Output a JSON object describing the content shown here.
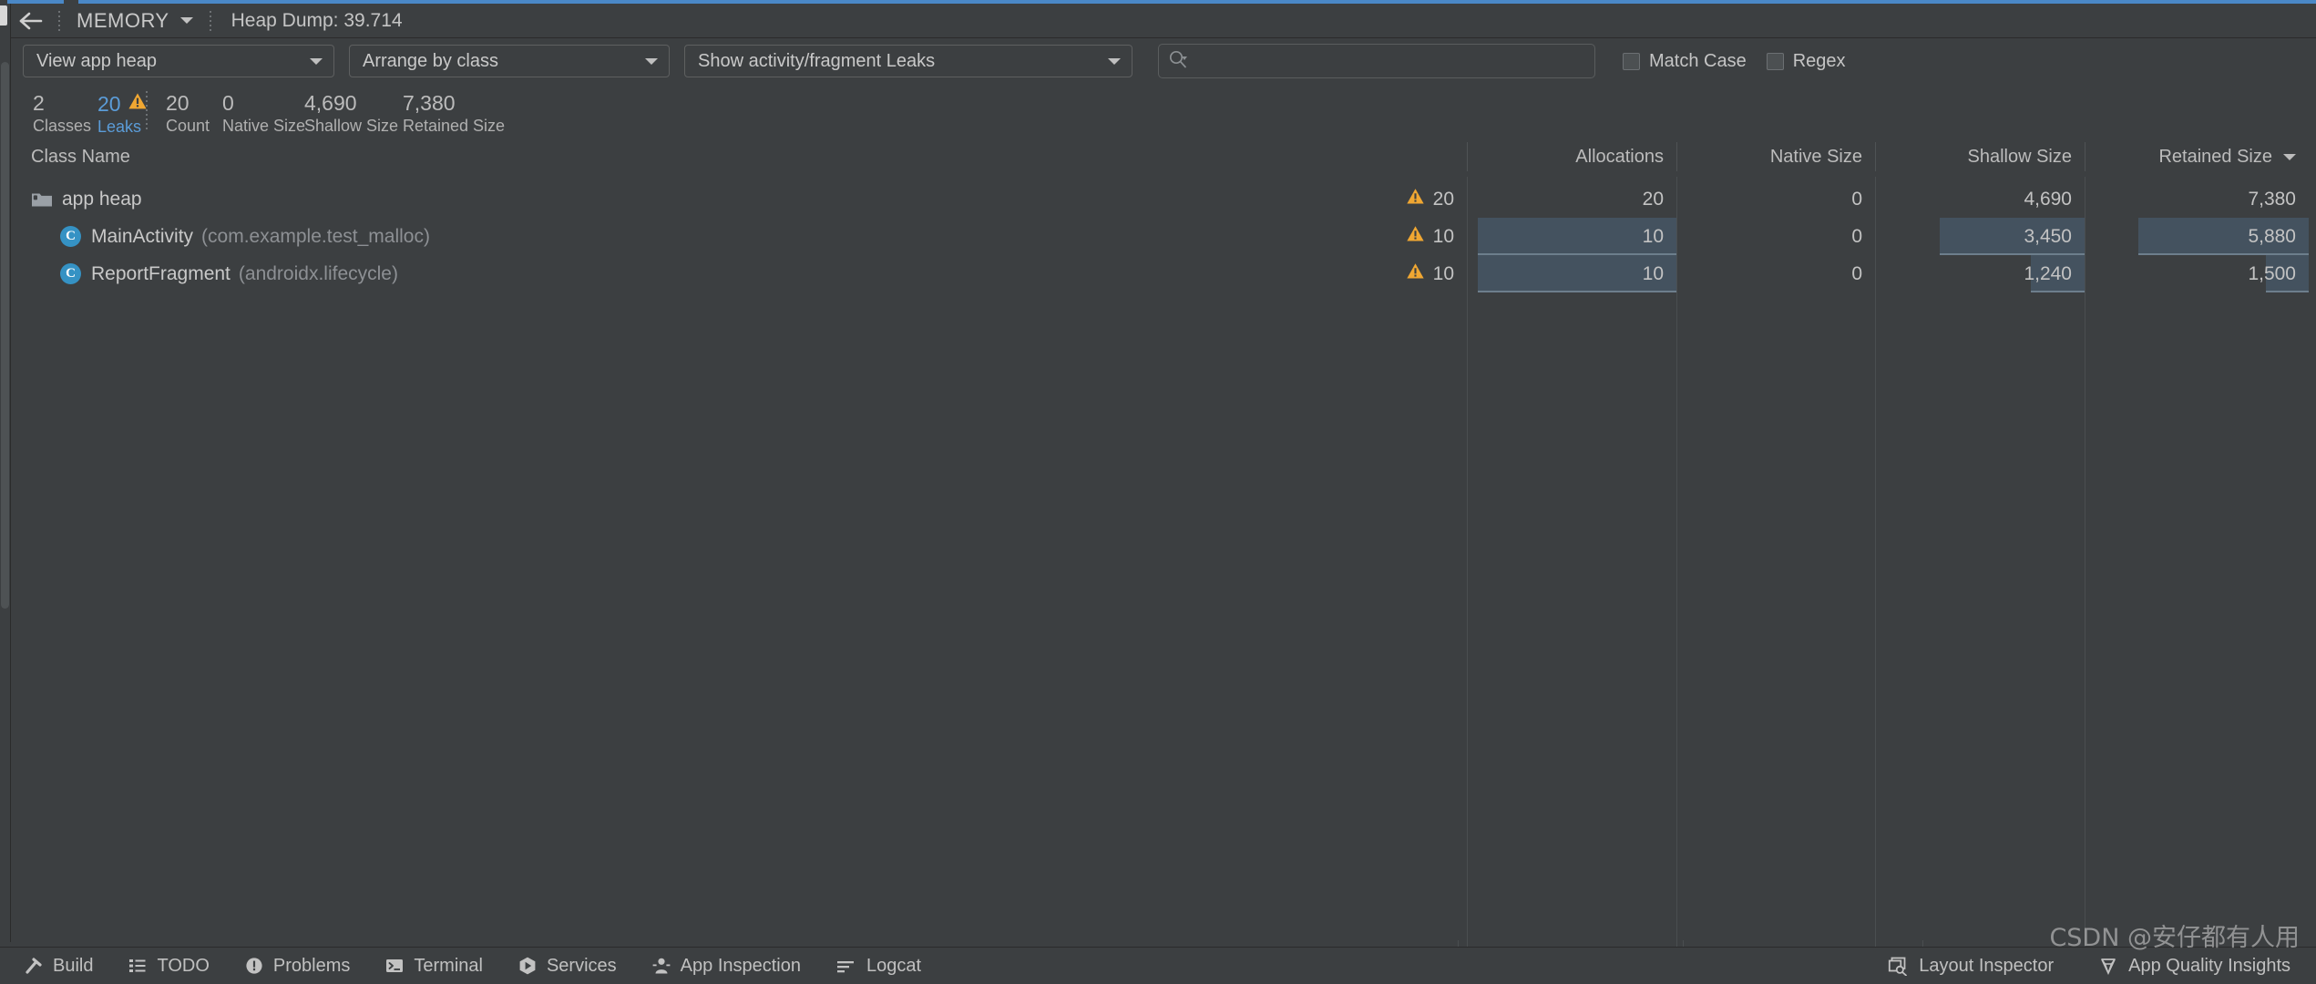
{
  "window": {
    "accent_color": "#4a88c7",
    "background": "#3c3f41"
  },
  "header": {
    "back_icon": "arrow-left-icon",
    "stage_label": "MEMORY",
    "stage_caret_icon": "chevron-down-icon",
    "dump_label": "Heap Dump: 39.714"
  },
  "toolbar": {
    "heap_filter": "View app heap",
    "arrange_filter": "Arrange by class",
    "leaks_filter": "Show activity/fragment Leaks",
    "search_placeholder": "",
    "search_value": "",
    "search_icon": "search-icon",
    "match_case_label": "Match Case",
    "regex_label": "Regex"
  },
  "stats": [
    {
      "value": "2",
      "caption": "Classes",
      "warn": false,
      "highlight": false
    },
    {
      "value": "20",
      "caption": "Leaks",
      "warn": true,
      "highlight": true
    },
    {
      "value": "20",
      "caption": "Count",
      "warn": false,
      "highlight": false
    },
    {
      "value": "0",
      "caption": "Native Size",
      "warn": false,
      "highlight": false
    },
    {
      "value": "4,690",
      "caption": "Shallow Size",
      "warn": false,
      "highlight": false
    },
    {
      "value": "7,380",
      "caption": "Retained Size",
      "warn": false,
      "highlight": false
    }
  ],
  "table": {
    "columns": [
      {
        "label": "Class Name",
        "align": "left",
        "sorted": false
      },
      {
        "label": "Allocations",
        "align": "right",
        "sorted": false
      },
      {
        "label": "Native Size",
        "align": "right",
        "sorted": false
      },
      {
        "label": "Shallow Size",
        "align": "right",
        "sorted": false
      },
      {
        "label": "Retained Size",
        "align": "right",
        "sorted": true
      }
    ],
    "sort_caret_icon": "chevron-down-icon",
    "rows": [
      {
        "icon": "folder-icon",
        "name": "app heap",
        "package": "",
        "depth": 0,
        "leaks": "20",
        "allocations": "20",
        "native_size": "0",
        "shallow_size": "4,690",
        "retained_size": "7,380",
        "bars": {
          "allocations": 0,
          "shallow_size": 0,
          "retained_size": 0
        }
      },
      {
        "icon": "class-icon",
        "name": "MainActivity",
        "package": "(com.example.test_malloc)",
        "depth": 1,
        "leaks": "10",
        "allocations": "10",
        "native_size": "0",
        "shallow_size": "3,450",
        "retained_size": "5,880",
        "bars": {
          "allocations": 1.0,
          "shallow_size": 0.73,
          "retained_size": 0.8
        }
      },
      {
        "icon": "class-icon",
        "name": "ReportFragment",
        "package": "(androidx.lifecycle)",
        "depth": 1,
        "leaks": "10",
        "allocations": "10",
        "native_size": "0",
        "shallow_size": "1,240",
        "retained_size": "1,500",
        "bars": {
          "allocations": 1.0,
          "shallow_size": 0.27,
          "retained_size": 0.2
        }
      }
    ],
    "warn_icon": "warning-triangle-icon",
    "bar_color": "#44525f"
  },
  "statusbar": {
    "left_items": [
      {
        "label": "Build",
        "icon": "hammer-icon"
      },
      {
        "label": "TODO",
        "icon": "list-icon"
      },
      {
        "label": "Problems",
        "icon": "exclamation-circle-icon"
      },
      {
        "label": "Terminal",
        "icon": "terminal-icon"
      },
      {
        "label": "Services",
        "icon": "play-hex-icon"
      },
      {
        "label": "App Inspection",
        "icon": "bug-person-icon"
      },
      {
        "label": "Logcat",
        "icon": "logcat-lines-icon"
      }
    ],
    "right_items": [
      {
        "label": "Layout Inspector",
        "icon": "layout-inspector-icon"
      },
      {
        "label": "App Quality Insights",
        "icon": "diamond-icon"
      }
    ]
  },
  "watermark": {
    "text": "CSDN @安仔都有人用"
  }
}
